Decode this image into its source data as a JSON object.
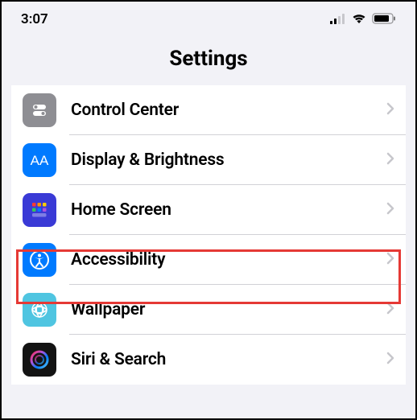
{
  "status": {
    "time": "3:07"
  },
  "header": {
    "title": "Settings"
  },
  "list": {
    "items": [
      {
        "label": "Control Center"
      },
      {
        "label": "Display & Brightness"
      },
      {
        "label": "Home Screen"
      },
      {
        "label": "Accessibility"
      },
      {
        "label": "Wallpaper"
      },
      {
        "label": "Siri & Search"
      }
    ]
  }
}
